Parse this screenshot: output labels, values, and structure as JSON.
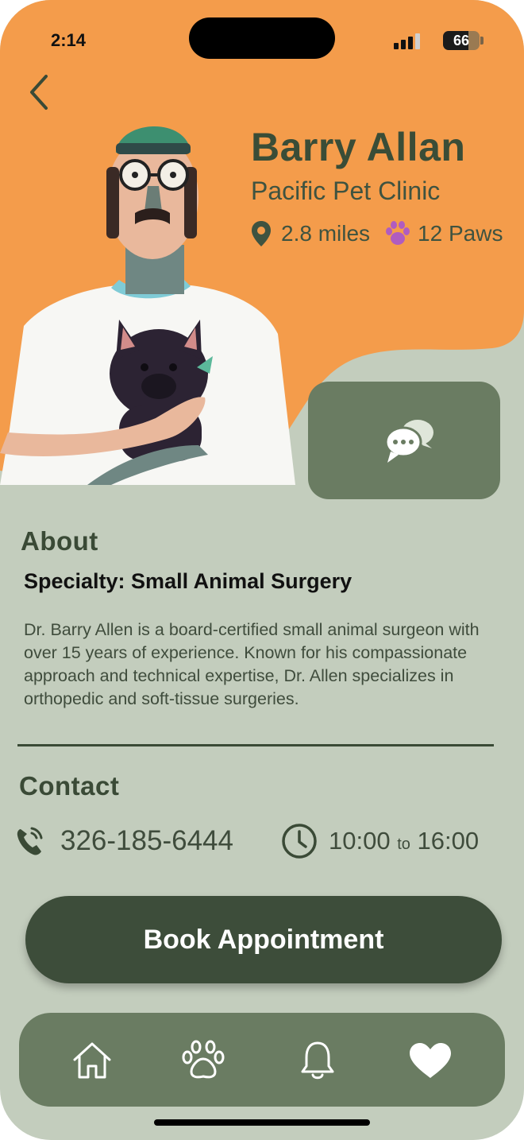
{
  "status_bar": {
    "time": "2:14",
    "battery": "66"
  },
  "doctor": {
    "name": "Barry Allan",
    "clinic": "Pacific Pet Clinic",
    "distance": "2.8 miles",
    "paws": "12 Paws"
  },
  "about": {
    "title": "About",
    "specialty": "Specialty: Small Animal Surgery",
    "bio": "Dr. Barry Allen is a board-certified small animal surgeon with over 15 years of experience. Known for his compassionate approach and technical expertise, Dr. Allen specializes in orthopedic and soft-tissue surgeries."
  },
  "contact": {
    "title": "Contact",
    "phone": "326-185-6444",
    "hours_open": "10:00",
    "hours_sep": "to",
    "hours_close": "16:00"
  },
  "actions": {
    "book": "Book Appointment"
  },
  "tabs": [
    {
      "icon": "home-icon"
    },
    {
      "icon": "paw-icon"
    },
    {
      "icon": "bell-icon"
    },
    {
      "icon": "heart-icon",
      "active": true
    }
  ],
  "colors": {
    "hero": "#f49c4b",
    "background": "#c3cdbd",
    "primary_dark": "#3d4d3a",
    "card": "#6a7c62",
    "paw_accent": "#b05cc0"
  }
}
